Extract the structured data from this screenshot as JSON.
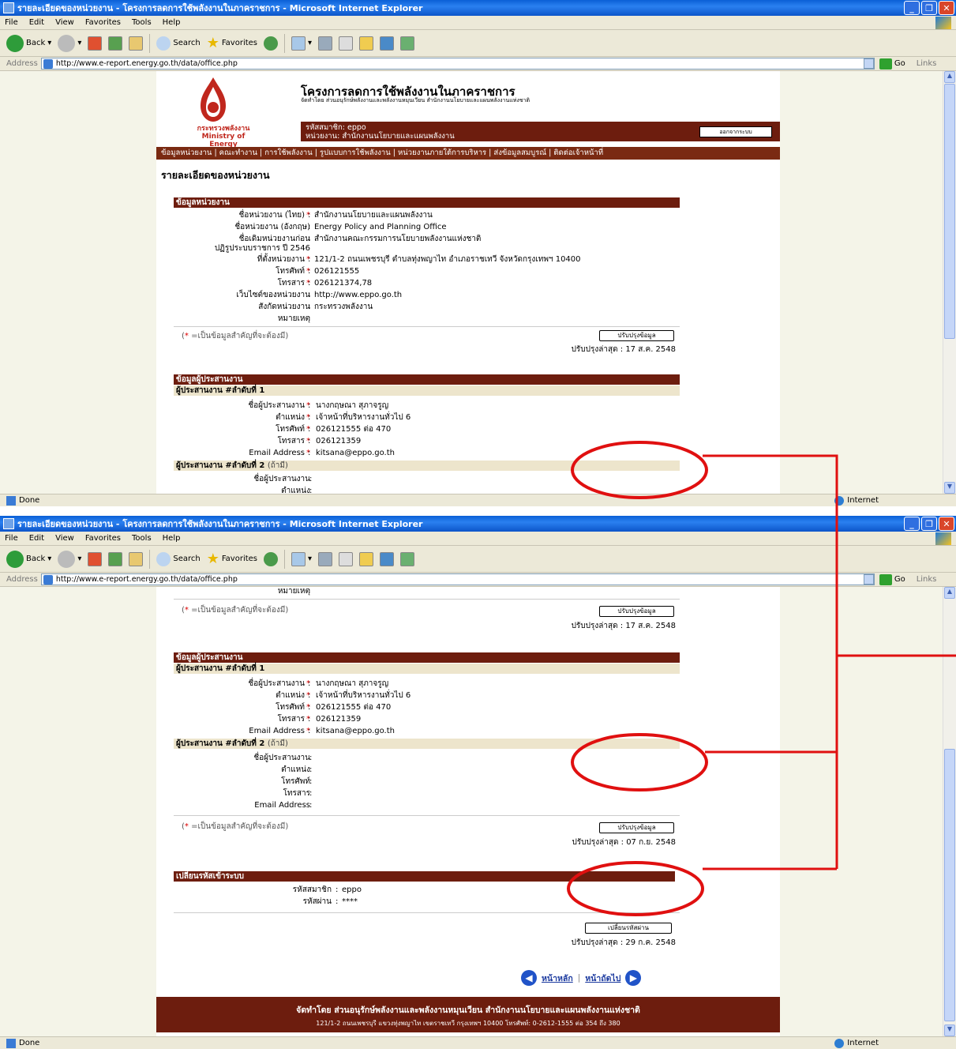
{
  "browser": {
    "title": "รายละเอียดของหน่วยงาน - โครงการลดการใช้พลังงานในภาคราชการ - Microsoft Internet Explorer",
    "menu": [
      "File",
      "Edit",
      "View",
      "Favorites",
      "Tools",
      "Help"
    ],
    "toolbar": {
      "back": "Back",
      "search": "Search",
      "favorites": "Favorites"
    },
    "address_label": "Address",
    "url": "http://www.e-report.energy.go.th/data/office.php",
    "go": "Go",
    "links": "Links",
    "status": "Done",
    "zone": "Internet"
  },
  "header": {
    "logo_th": "กระทรวงพลังงาน",
    "logo_en": "Ministry of Energy",
    "project_title": "โครงการลดการใช้พลังงานในภาคราชการ",
    "project_sub": "จัดทำโดย ส่วนอนุรักษ์พลังงานและพลังงานหมุนเวียน สำนักงานนโยบายและแผนพลังงานแห่งชาติ",
    "member_label": "รหัสสมาชิก",
    "member_value": "eppo",
    "unit_label": "หน่วยงาน",
    "unit_value": "สำนักงานนโยบายและแผนพลังงาน",
    "logout": "ออกจากระบบ"
  },
  "nav": [
    "ข้อมูลหน่วยงาน",
    "คณะทำงาน",
    "การใช้พลังงาน",
    "รูปแบบการใช้พลังงาน",
    "หน่วยงานภายใต้การบริหาร",
    "ส่งข้อมูลสมบูรณ์",
    "ติดต่อเจ้าหน้าที่"
  ],
  "page_title": "รายละเอียดของหน่วยงาน",
  "unit_section": {
    "heading": "ข้อมูลหน่วยงาน",
    "rows": [
      {
        "label": "ชื่อหน่วยงาน (ไทย)",
        "req": true,
        "value": "สำนักงานนโยบายและแผนพลังงาน"
      },
      {
        "label": "ชื่อหน่วยงาน (อังกฤษ)",
        "req": false,
        "value": "Energy Policy and Planning Office"
      },
      {
        "label": "ชื่อเดิมหน่วยงานก่อน",
        "req": false,
        "value": "สำนักงานคณะกรรมการนโยบายพลังงานแห่งชาติ"
      },
      {
        "label": "ปฏิรูประบบราชการ ปี 2546",
        "req": false,
        "value": ""
      },
      {
        "label": "ที่ตั้งหน่วยงาน",
        "req": true,
        "value": "121/1-2 ถนนเพชรบุรี ตำบลทุ่งพญาไท อำเภอราชเทวี จังหวัดกรุงเทพฯ 10400"
      },
      {
        "label": "โทรศัพท์",
        "req": true,
        "value": "026121555"
      },
      {
        "label": "โทรสาร",
        "req": true,
        "value": "026121374,78"
      },
      {
        "label": "เว็บไซต์ของหน่วยงาน",
        "req": false,
        "value": "http://www.eppo.go.th"
      },
      {
        "label": "สังกัดหน่วยงาน",
        "req": false,
        "value": "กระทรวงพลังงาน"
      },
      {
        "label": "หมายเหตุ",
        "req": false,
        "value": ""
      }
    ],
    "note": "=เป็นข้อมูลสำคัญที่จะต้องมี)",
    "update_button": "ปรับปรุงข้อมูล",
    "updated": "ปรับปรุงล่าสุด : 17 ส.ค. 2548"
  },
  "coord_section": {
    "heading": "ข้อมูลผู้ประสานงาน",
    "coord1_heading": "ผู้ประสานงาน #ลำดับที่ 1",
    "coord1": [
      {
        "label": "ชื่อผู้ประสานงาน",
        "req": true,
        "value": "นางกฤษณา สุภาจรูญ"
      },
      {
        "label": "ตำแหน่ง",
        "req": true,
        "value": "เจ้าหน้าที่บริหารงานทั่วไป 6"
      },
      {
        "label": "โทรศัพท์",
        "req": true,
        "value": "026121555 ต่อ 470"
      },
      {
        "label": "โทรสาร",
        "req": true,
        "value": "026121359"
      },
      {
        "label": "Email Address",
        "req": true,
        "value": "kitsana@eppo.go.th"
      }
    ],
    "coord2_heading": "ผู้ประสานงาน #ลำดับที่ 2",
    "coord2_optional": "(ถ้ามี)",
    "coord2": [
      {
        "label": "ชื่อผู้ประสานงาน",
        "value": ""
      },
      {
        "label": "ตำแหน่ง",
        "value": ""
      },
      {
        "label": "โทรศัพท์",
        "value": ""
      },
      {
        "label": "โทรสาร",
        "value": ""
      },
      {
        "label": "Email Address",
        "value": ""
      }
    ],
    "updated": "ปรับปรุงล่าสุด : 07 ก.ย. 2548"
  },
  "password_section": {
    "heading": "เปลี่ยนรหัสเข้าระบบ",
    "member_label": "รหัสสมาชิก",
    "member_value": "eppo",
    "password_label": "รหัสผ่าน",
    "password_value": "****",
    "change_button": "เปลี่ยนรหัสผ่าน",
    "updated": "ปรับปรุงล่าสุด : 29 ก.ค. 2548"
  },
  "pager": {
    "home": "หน้าหลัก",
    "next": "หน้าถัดไป"
  },
  "footer": {
    "line1": "จัดทำโดย ส่วนอนุรักษ์พลังงานและพลังงานหมุนเวียน สำนักงานนโยบายและแผนพลังงานแห่งชาติ",
    "line2": "121/1-2 ถนนเพชรบุรี แขวงทุ่งพญาไท เขตราชเทวี กรุงเทพฯ 10400 โทรศัพท์: 0-2612-1555 ต่อ 354 ถึง 380"
  },
  "colors": {
    "brand": "#6d1d0e",
    "annotation": "#e01010",
    "titlebar": "#0a5fd6"
  }
}
